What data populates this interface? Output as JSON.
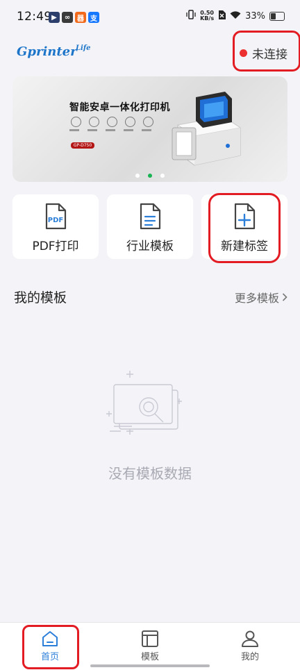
{
  "status_bar": {
    "time": "12:49",
    "net_speed_value": "0.50",
    "net_speed_unit": "KB/s",
    "battery": "33%",
    "battery_level": 0.33
  },
  "header": {
    "logo": "Gprinter",
    "logo_sup": "Life",
    "connection_status": "未连接",
    "connection_color": "#ec2f2f"
  },
  "banner": {
    "title": "智能安卓一体化打印机",
    "model": "GP-D750",
    "slide_count": 3,
    "active_slide": 2
  },
  "actions": [
    {
      "label": "PDF打印",
      "icon": "pdf-file-icon"
    },
    {
      "label": "行业模板",
      "icon": "document-lines-icon"
    },
    {
      "label": "新建标签",
      "icon": "new-file-plus-icon"
    }
  ],
  "templates": {
    "title": "我的模板",
    "more": "更多模板",
    "empty": "没有模板数据"
  },
  "nav": [
    {
      "label": "首页",
      "icon": "home-icon",
      "active": true
    },
    {
      "label": "模板",
      "icon": "template-icon",
      "active": false
    },
    {
      "label": "我的",
      "icon": "user-icon",
      "active": false
    }
  ],
  "colors": {
    "accent": "#2b7fd9",
    "logo": "#1d75c9",
    "highlight": "#e31b23",
    "active_dot": "#19b354"
  }
}
